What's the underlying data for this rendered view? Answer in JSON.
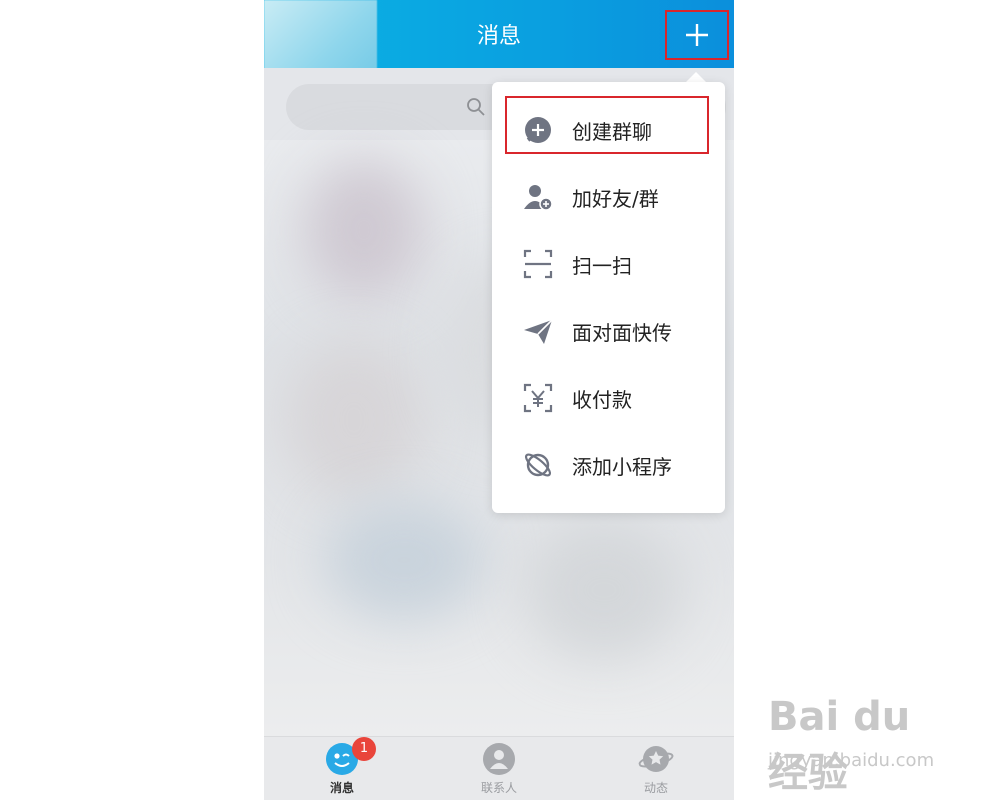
{
  "header": {
    "title": "消息"
  },
  "menu": {
    "items": [
      {
        "label": "创建群聊",
        "icon": "add-group-chat-icon"
      },
      {
        "label": "加好友/群",
        "icon": "add-friend-icon"
      },
      {
        "label": "扫一扫",
        "icon": "scan-icon"
      },
      {
        "label": "面对面快传",
        "icon": "paper-plane-icon"
      },
      {
        "label": "收付款",
        "icon": "payment-scan-icon"
      },
      {
        "label": "添加小程序",
        "icon": "planet-icon"
      }
    ]
  },
  "tabbar": {
    "tabs": [
      {
        "label": "消息",
        "badge": "1",
        "active": true
      },
      {
        "label": "联系人"
      },
      {
        "label": "动态"
      }
    ]
  },
  "watermark": {
    "logo": "Bai du 经验",
    "url": "jingyan.baidu.com"
  },
  "colors": {
    "header_blue": "#0a9fe0",
    "highlight_red": "#d9262c",
    "badge_red": "#e9453b"
  }
}
